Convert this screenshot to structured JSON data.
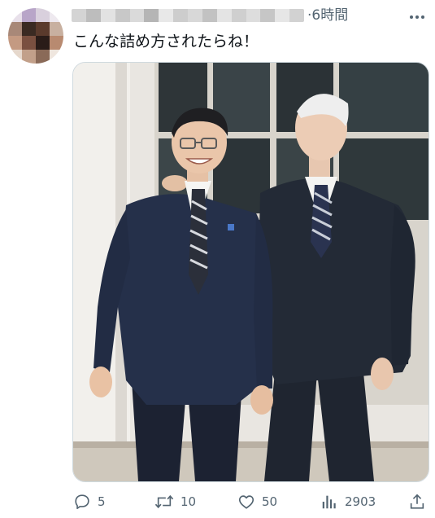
{
  "tweet": {
    "time": "·6時間",
    "text": "こんな詰め方されたらね！"
  },
  "icons": {
    "more": "more-horizontal-icon",
    "reply": "reply-icon",
    "retweet": "retweet-icon",
    "like": "heart-icon",
    "views": "views-chart-icon",
    "share": "share-icon"
  },
  "actions": {
    "reply_count": "5",
    "retweet_count": "10",
    "like_count": "50",
    "view_count": "2903"
  },
  "colors": {
    "text_primary": "#0f1419",
    "text_secondary": "#536471",
    "border": "#cfd9de"
  }
}
